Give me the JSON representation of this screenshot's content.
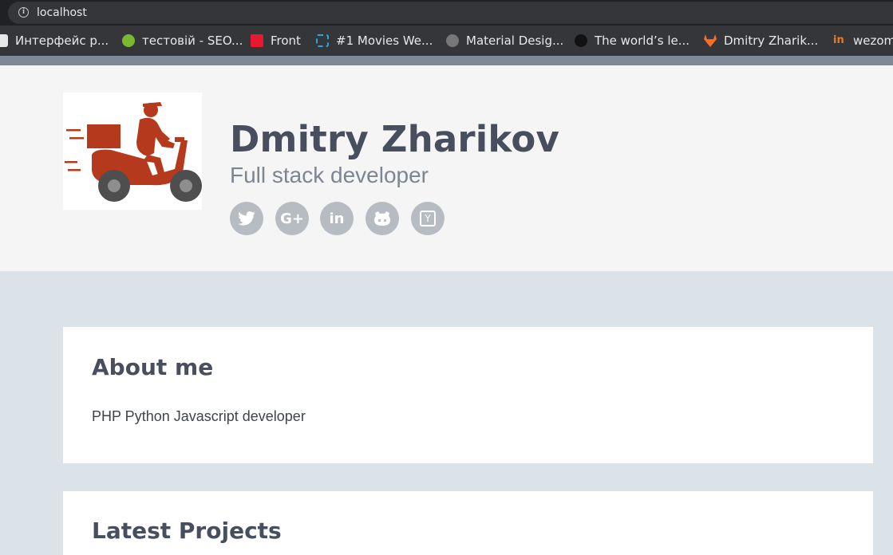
{
  "browser": {
    "url": "localhost",
    "bookmarks": [
      {
        "label": "Интерфейс р...",
        "icon": "page-icon"
      },
      {
        "label": "тестовій - SEO...",
        "icon": "seo-icon"
      },
      {
        "label": "Front",
        "icon": "heart-icon"
      },
      {
        "label": "#1 Movies We...",
        "icon": "movies-icon"
      },
      {
        "label": "Material Desig...",
        "icon": "globe-icon"
      },
      {
        "label": "The world’s le...",
        "icon": "github-icon"
      },
      {
        "label": "Dmitry Zharik...",
        "icon": "gitlab-icon"
      },
      {
        "label": "wezom",
        "icon": "wezom-icon"
      }
    ]
  },
  "profile": {
    "name": "Dmitry Zharikov",
    "tagline": "Full stack developer",
    "social": [
      {
        "name": "twitter",
        "icon": "twitter-icon"
      },
      {
        "name": "google-plus",
        "icon": "google-plus-icon",
        "glyph": "G+"
      },
      {
        "name": "linkedin",
        "icon": "linkedin-icon",
        "glyph": "in"
      },
      {
        "name": "github",
        "icon": "github-icon"
      },
      {
        "name": "hacker-news",
        "icon": "hacker-news-icon",
        "glyph": "Y"
      }
    ]
  },
  "about": {
    "title": "About me",
    "text": "PHP Python Javascript developer"
  },
  "projects": {
    "title": "Latest Projects"
  },
  "colors": {
    "avatar_illustration": "#b5391d",
    "social_circle": "#b6bcc1",
    "heading": "#474e5d",
    "page_bg": "#dbe2e8"
  }
}
